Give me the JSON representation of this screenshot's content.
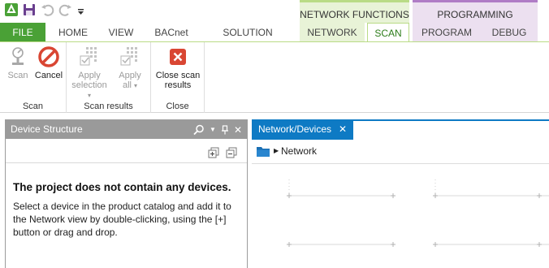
{
  "titlebar": {
    "contextual_groups": {
      "network_functions": "NETWORK FUNCTIONS",
      "programming_functions": "PROGRAMMING FUNCTIONS"
    }
  },
  "tabs": {
    "file": "FILE",
    "home": "HOME",
    "view": "VIEW",
    "bacnet": "BACnet",
    "solution_builder": "SOLUTION BUILDER",
    "network": "NETWORK",
    "scan": "SCAN",
    "program": "PROGRAM",
    "debug": "DEBUG"
  },
  "ribbon": {
    "groups": {
      "scan": "Scan",
      "scan_results": "Scan results",
      "close": "Close"
    },
    "buttons": {
      "scan": "Scan",
      "cancel": "Cancel",
      "apply_selection_line1": "Apply",
      "apply_selection_line2": "selection",
      "apply_all_line1": "Apply",
      "apply_all_line2": "all",
      "close_scan_line1": "Close scan",
      "close_scan_line2": "results"
    }
  },
  "device_structure": {
    "title": "Device Structure",
    "empty_title": "The project does not contain any devices.",
    "empty_message": "Select a device in the product catalog and add it to the Network view by double-clicking, using the [+] button  or drag and drop."
  },
  "network_devices": {
    "tab_label": "Network/Devices",
    "breadcrumb": "Network"
  },
  "colors": {
    "file_tab": "#4aa136",
    "network_context": "#e8f3d7",
    "programming_context": "#ece0f0",
    "document_tab": "#0e7ac4",
    "panel_header": "#9a9a9a",
    "cancel_red": "#d94633"
  }
}
